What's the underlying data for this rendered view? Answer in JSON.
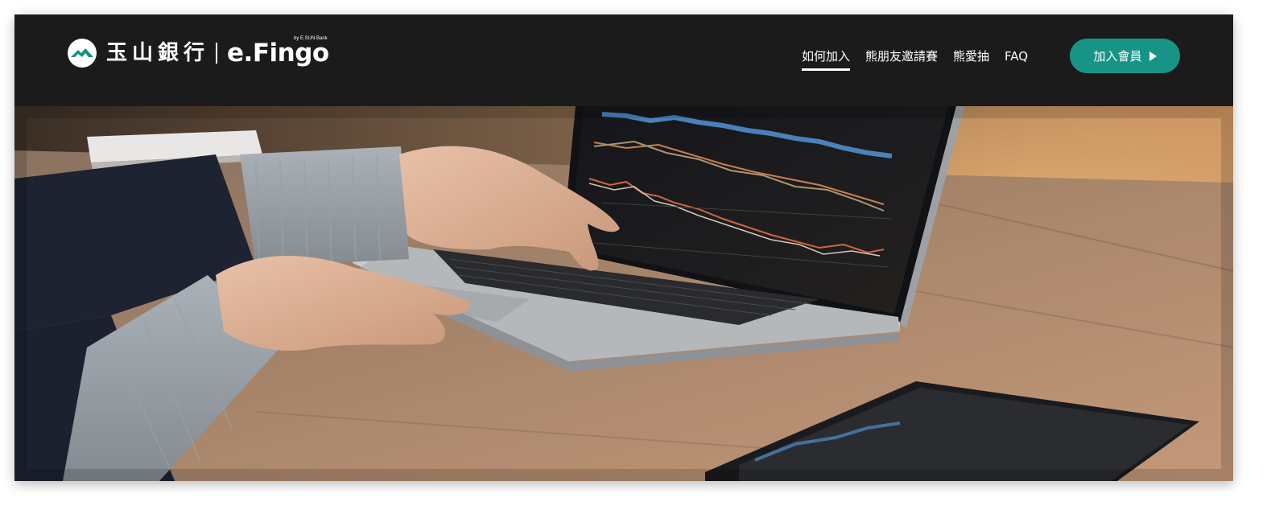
{
  "header": {
    "brand_cn": "玉山銀行",
    "brand_product": "e.Fingo",
    "brand_by": "by E.SUN Bank"
  },
  "nav": {
    "items": [
      {
        "label": "如何加入",
        "active": true
      },
      {
        "label": "熊朋友邀請賽",
        "active": false
      },
      {
        "label": "熊愛抽",
        "active": false
      },
      {
        "label": "FAQ",
        "active": false
      }
    ]
  },
  "cta": {
    "label": "加入會員",
    "icon": "play-icon",
    "color": "#179485"
  },
  "colors": {
    "navbar_bg": "#1b1b1b",
    "accent": "#179485"
  },
  "hero": {
    "image": "photo-hands-typing-on-laptop-with-stock-charts"
  }
}
